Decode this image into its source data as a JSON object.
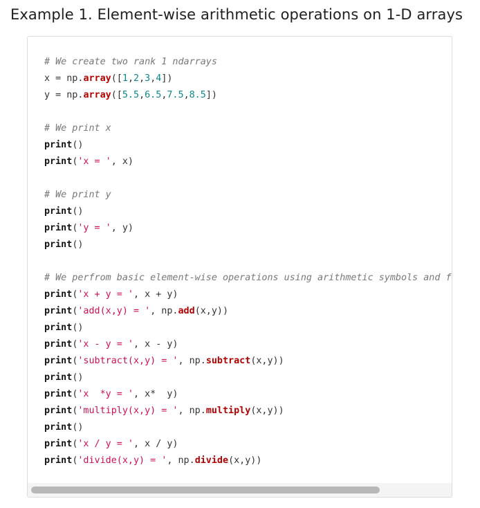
{
  "heading": "Example 1. Element-wise arithmetic operations on 1-D arrays",
  "code_lines": [
    [
      {
        "t": "# We create two rank 1 ndarrays",
        "c": "c"
      }
    ],
    [
      {
        "t": "x = np."
      },
      {
        "t": "array",
        "c": "f"
      },
      {
        "t": "(["
      },
      {
        "t": "1",
        "c": "n"
      },
      {
        "t": ","
      },
      {
        "t": "2",
        "c": "n"
      },
      {
        "t": ","
      },
      {
        "t": "3",
        "c": "n"
      },
      {
        "t": ","
      },
      {
        "t": "4",
        "c": "n"
      },
      {
        "t": "])"
      }
    ],
    [
      {
        "t": "y = np."
      },
      {
        "t": "array",
        "c": "f"
      },
      {
        "t": "(["
      },
      {
        "t": "5.5",
        "c": "n"
      },
      {
        "t": ","
      },
      {
        "t": "6.5",
        "c": "n"
      },
      {
        "t": ","
      },
      {
        "t": "7.5",
        "c": "n"
      },
      {
        "t": ","
      },
      {
        "t": "8.5",
        "c": "n"
      },
      {
        "t": "])"
      }
    ],
    [],
    [
      {
        "t": "# We print x",
        "c": "c"
      }
    ],
    [
      {
        "t": "print",
        "c": "k"
      },
      {
        "t": "()"
      }
    ],
    [
      {
        "t": "print",
        "c": "k"
      },
      {
        "t": "("
      },
      {
        "t": "'x = '",
        "c": "s"
      },
      {
        "t": ", x)"
      }
    ],
    [],
    [
      {
        "t": "# We print y",
        "c": "c"
      }
    ],
    [
      {
        "t": "print",
        "c": "k"
      },
      {
        "t": "()"
      }
    ],
    [
      {
        "t": "print",
        "c": "k"
      },
      {
        "t": "("
      },
      {
        "t": "'y = '",
        "c": "s"
      },
      {
        "t": ", y)"
      }
    ],
    [
      {
        "t": "print",
        "c": "k"
      },
      {
        "t": "()"
      }
    ],
    [],
    [
      {
        "t": "# We perfrom basic element-wise operations using arithmetic symbols and functions",
        "c": "c"
      }
    ],
    [
      {
        "t": "print",
        "c": "k"
      },
      {
        "t": "("
      },
      {
        "t": "'x + y = '",
        "c": "s"
      },
      {
        "t": ", x + y)"
      }
    ],
    [
      {
        "t": "print",
        "c": "k"
      },
      {
        "t": "("
      },
      {
        "t": "'add(x,y) = '",
        "c": "s"
      },
      {
        "t": ", np."
      },
      {
        "t": "add",
        "c": "f"
      },
      {
        "t": "(x,y))"
      }
    ],
    [
      {
        "t": "print",
        "c": "k"
      },
      {
        "t": "()"
      }
    ],
    [
      {
        "t": "print",
        "c": "k"
      },
      {
        "t": "("
      },
      {
        "t": "'x - y = '",
        "c": "s"
      },
      {
        "t": ", x - y)"
      }
    ],
    [
      {
        "t": "print",
        "c": "k"
      },
      {
        "t": "("
      },
      {
        "t": "'subtract(x,y) = '",
        "c": "s"
      },
      {
        "t": ", np."
      },
      {
        "t": "subtract",
        "c": "f"
      },
      {
        "t": "(x,y))"
      }
    ],
    [
      {
        "t": "print",
        "c": "k"
      },
      {
        "t": "()"
      }
    ],
    [
      {
        "t": "print",
        "c": "k"
      },
      {
        "t": "("
      },
      {
        "t": "'x  *y = '",
        "c": "s"
      },
      {
        "t": ", x*  y)"
      }
    ],
    [
      {
        "t": "print",
        "c": "k"
      },
      {
        "t": "("
      },
      {
        "t": "'multiply(x,y) = '",
        "c": "s"
      },
      {
        "t": ", np."
      },
      {
        "t": "multiply",
        "c": "f"
      },
      {
        "t": "(x,y))"
      }
    ],
    [
      {
        "t": "print",
        "c": "k"
      },
      {
        "t": "()"
      }
    ],
    [
      {
        "t": "print",
        "c": "k"
      },
      {
        "t": "("
      },
      {
        "t": "'x / y = '",
        "c": "s"
      },
      {
        "t": ", x / y)"
      }
    ],
    [
      {
        "t": "print",
        "c": "k"
      },
      {
        "t": "("
      },
      {
        "t": "'divide(x,y) = '",
        "c": "s"
      },
      {
        "t": ", np."
      },
      {
        "t": "divide",
        "c": "f"
      },
      {
        "t": "(x,y))"
      }
    ]
  ]
}
